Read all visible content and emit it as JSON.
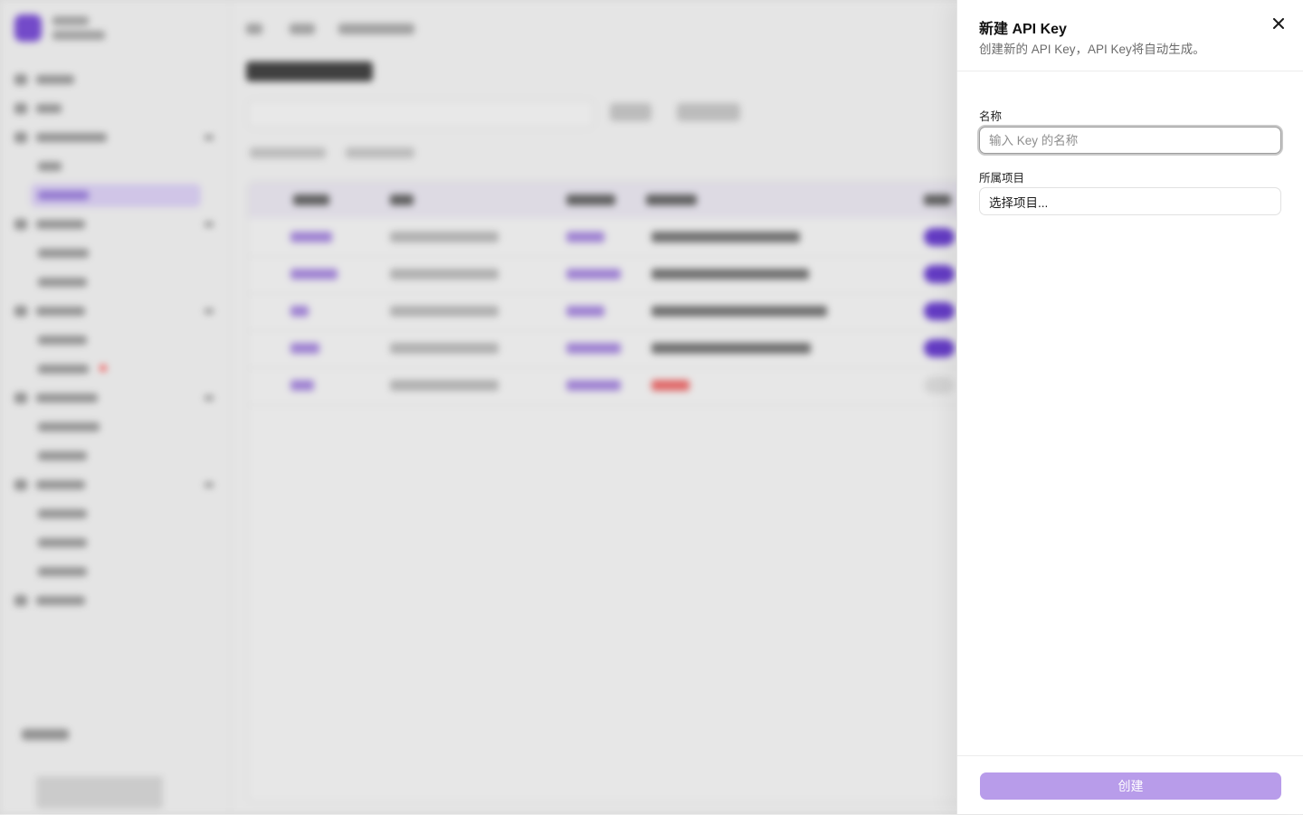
{
  "sheet": {
    "title": "新建 API Key",
    "description": "创建新的 API Key，API Key将自动生成。",
    "close_icon": "close-icon",
    "name_field": {
      "label": "名称",
      "placeholder": "输入 Key 的名称",
      "value": ""
    },
    "project_field": {
      "label": "所属项目",
      "value": "选择项目..."
    },
    "create_button": {
      "label": "创建",
      "state": "disabled",
      "color": "#b89cea"
    }
  },
  "colors": {
    "accent": "#7b4fd6",
    "accent_light": "#b89cea",
    "overlay": "#e6e6e6"
  }
}
